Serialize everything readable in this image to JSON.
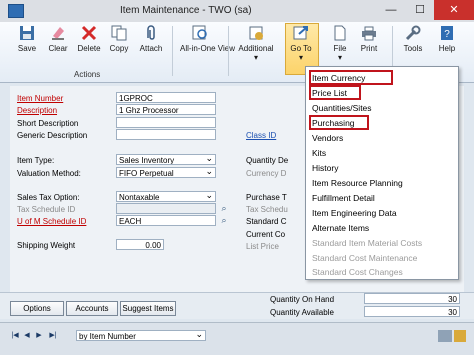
{
  "window": {
    "title": "Item Maintenance  -  TWO (sa)",
    "minimize": "—",
    "maximize": "☐",
    "close": "✕"
  },
  "toolbar": {
    "save": "Save",
    "clear": "Clear",
    "delete": "Delete",
    "copy": "Copy",
    "attach": "Attach",
    "all_in_one_view": "All-in-One View",
    "additional": "Additional",
    "goto": "Go To",
    "file": "File",
    "print": "Print",
    "tools": "Tools",
    "help": "Help",
    "actions_group": "Actions"
  },
  "form": {
    "item_number_label": "Item Number",
    "item_number": "1GPROC",
    "description_label": "Description",
    "description": "1 Ghz Processor",
    "short_description_label": "Short Description",
    "short_description": "",
    "generic_description_label": "Generic Description",
    "generic_description": "",
    "class_id_label": "Class ID",
    "item_type_label": "Item Type:",
    "item_type": "Sales Inventory",
    "valuation_method_label": "Valuation Method:",
    "valuation_method": "FIFO Perpetual",
    "sales_tax_option_label": "Sales Tax Option:",
    "sales_tax_option": "Nontaxable",
    "tax_schedule_id_label": "Tax Schedule ID",
    "tax_schedule_id": "",
    "uofm_schedule_id_label": "U of M Schedule ID",
    "uofm_schedule_id": "EACH",
    "shipping_weight_label": "Shipping Weight",
    "shipping_weight": "0.00",
    "quantity_decimals_label": "Quantity De",
    "currency_decimals_label": "Currency D",
    "purchase_tax_label": "Purchase T",
    "purchase_tax_label2": "Tax Schedu",
    "standard_cost_label": "Standard C",
    "current_cost_label": "Current Co",
    "list_price_label": "List Price"
  },
  "bottom": {
    "options": "Options",
    "accounts": "Accounts",
    "suggest_items": "Suggest Items",
    "quantity_on_hand_label": "Quantity On Hand",
    "quantity_on_hand": "30",
    "quantity_available_label": "Quantity Available",
    "quantity_available": "30"
  },
  "status": {
    "sort": "by Item Number",
    "first": "|◀",
    "prev": "◀",
    "next": "▶",
    "last": "▶|"
  },
  "goto_menu": {
    "items": [
      {
        "label": "Item Currency",
        "enabled": true,
        "highlighted": true
      },
      {
        "label": "Price List",
        "enabled": true,
        "highlighted": true
      },
      {
        "label": "Quantities/Sites",
        "enabled": true,
        "highlighted": false
      },
      {
        "label": "Purchasing",
        "enabled": true,
        "highlighted": true
      },
      {
        "label": "Vendors",
        "enabled": true,
        "highlighted": false
      },
      {
        "label": "Kits",
        "enabled": true,
        "highlighted": false
      },
      {
        "label": "History",
        "enabled": true,
        "highlighted": false
      },
      {
        "label": "Item Resource Planning",
        "enabled": true,
        "highlighted": false
      },
      {
        "label": "Fulfillment Detail",
        "enabled": true,
        "highlighted": false
      },
      {
        "label": "Item Engineering Data",
        "enabled": true,
        "highlighted": false
      },
      {
        "label": "Alternate Items",
        "enabled": true,
        "highlighted": false
      },
      {
        "label": "Standard Item Material Costs",
        "enabled": false,
        "highlighted": false
      },
      {
        "label": "Standard Cost Maintenance",
        "enabled": false,
        "highlighted": false
      },
      {
        "label": "Standard Cost Changes",
        "enabled": false,
        "highlighted": false
      }
    ]
  },
  "colors": {
    "highlight_border": "#c0141c",
    "required_label": "#c00000",
    "link": "#1a4fb0"
  }
}
